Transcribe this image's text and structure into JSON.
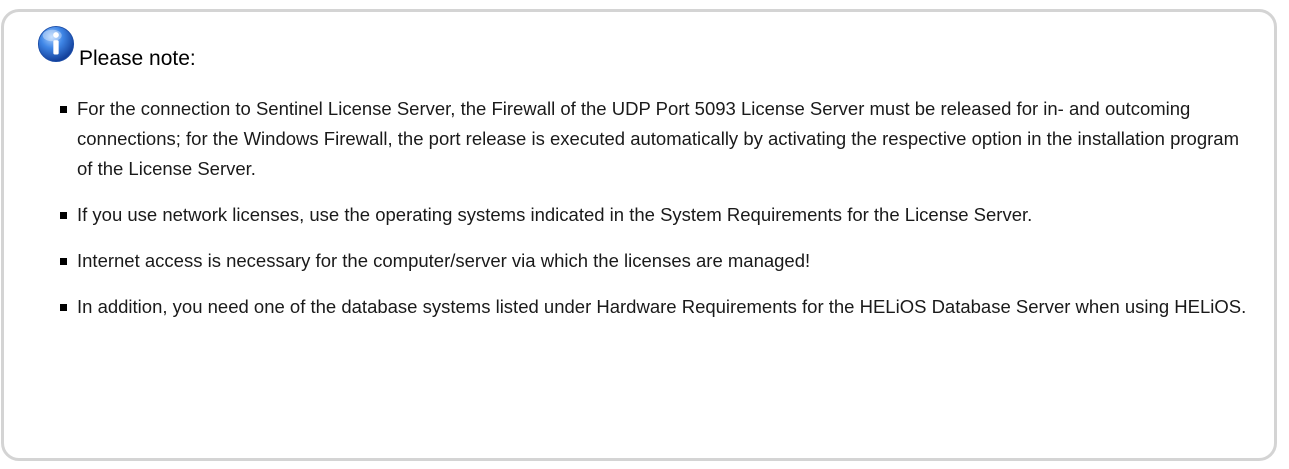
{
  "note": {
    "icon": "info-icon",
    "title": "Please note:",
    "items": [
      {
        "text": "For the connection to Sentinel License Server, the Firewall of the UDP Port 5093 License Server must be released for in- and outcoming connections; for the Windows Firewall, the port release is executed automatically by activating the respective option in the installation program of the License Server."
      },
      {
        "text": "If you use network licenses, use the operating systems indicated in the System Requirements for the License Server."
      },
      {
        "text": "Internet access is necessary for the computer/server via which the licenses are managed!"
      },
      {
        "text": "In addition, you need one of the database systems listed under Hardware Requirements for the HELiOS Database Server when using HELiOS."
      }
    ]
  },
  "colors": {
    "border": "#d4d4d4",
    "icon_blue": "#2f6fd0",
    "text": "#1a1a1a"
  }
}
